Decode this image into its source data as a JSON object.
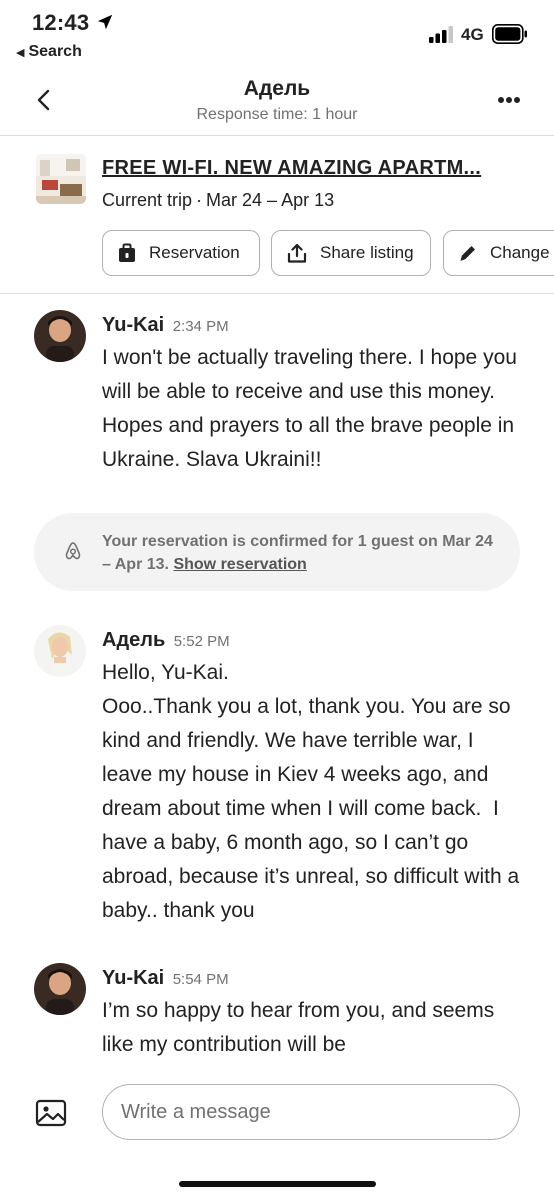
{
  "status_bar": {
    "time": "12:43",
    "back_app": "Search",
    "network": "4G"
  },
  "header": {
    "host_name": "Адель",
    "response_time": "Response time: 1 hour"
  },
  "listing": {
    "title": "FREE WI-FI. NEW AMAZING APARTM...",
    "trip_label": "Current trip",
    "separator": "·",
    "dates": "Mar 24 – Apr 13",
    "actions": {
      "reservation": "Reservation",
      "share": "Share listing",
      "change": "Change"
    }
  },
  "messages": [
    {
      "sender": "Yu-Kai",
      "time": "2:34 PM",
      "text": "I won't be actually traveling there. I hope you will be able to receive and use this money. Hopes and prayers to all the brave people in Ukraine. Slava Ukraini!!"
    },
    {
      "sender": "Адель",
      "time": "5:52 PM",
      "text": "Hello, Yu-Kai.\nOoo..Thank you a lot, thank you. You are so kind and friendly. We have terrible war, I leave my house in Kiev 4 weeks ago, and dream about time when I will come back.  I have a baby, 6 month ago, so I can’t go abroad, because it’s unreal, so difficult with a baby.. thank you"
    },
    {
      "sender": "Yu-Kai",
      "time": "5:54 PM",
      "text": "I’m so happy to hear from you, and seems like my contribution will be"
    }
  ],
  "notice": {
    "text": "Your reservation is confirmed for 1 guest on Mar 24 – Apr 13.",
    "link": "Show reservation"
  },
  "composer": {
    "placeholder": "Write a message"
  },
  "colors": {
    "text": "#222222",
    "muted": "#717171",
    "border": "#dddddd",
    "notice_bg": "#f3f3f3"
  }
}
